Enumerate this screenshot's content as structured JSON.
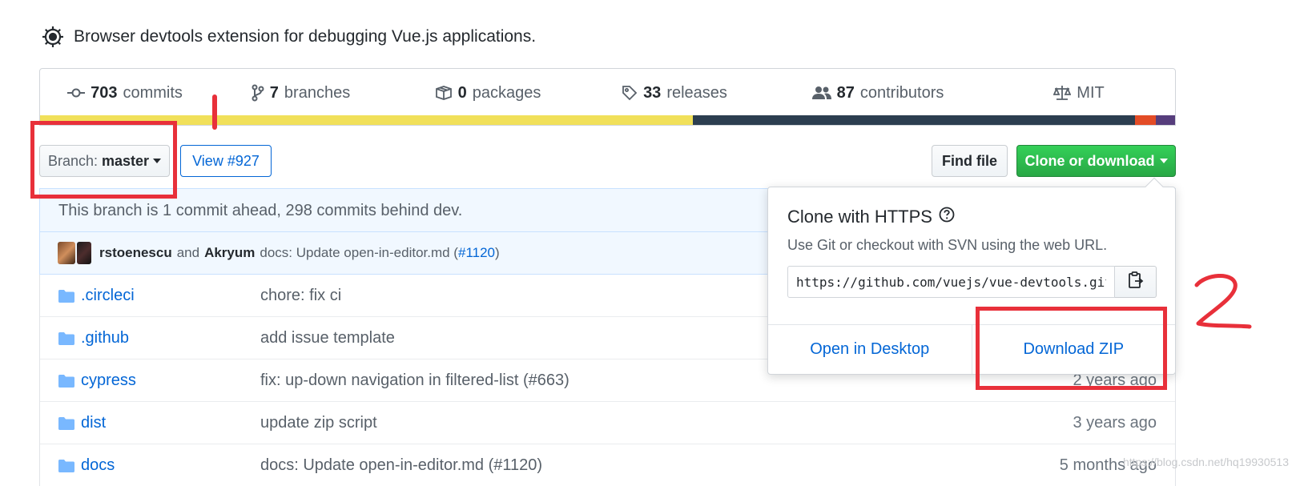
{
  "repo": {
    "description": "Browser devtools extension for debugging Vue.js applications."
  },
  "stats": [
    {
      "icon": "commits-icon",
      "count": "703",
      "label": "commits"
    },
    {
      "icon": "branch-icon",
      "count": "7",
      "label": "branches"
    },
    {
      "icon": "package-icon",
      "count": "0",
      "label": "packages"
    },
    {
      "icon": "tag-icon",
      "count": "33",
      "label": "releases"
    },
    {
      "icon": "people-icon",
      "count": "87",
      "label": "contributors"
    },
    {
      "icon": "law-icon",
      "count": "",
      "label": "MIT"
    }
  ],
  "language_bar": [
    {
      "color": "#f1e05a",
      "fraction": 0.575
    },
    {
      "color": "#2c3e50",
      "fraction": 0.39
    },
    {
      "color": "#e34c26",
      "fraction": 0.018
    },
    {
      "color": "#563d7c",
      "fraction": 0.017
    }
  ],
  "toolbar": {
    "branch_prefix": "Branch:",
    "branch_name": "master",
    "view_pr": "View #927",
    "find_file": "Find file",
    "clone_download": "Clone or download"
  },
  "branch_status": "This branch is 1 commit ahead, 298 commits behind dev.",
  "latest_commit": {
    "author1": "rstoenescu",
    "joiner": "and",
    "author2": "Akryum",
    "message_prefix": "docs: Update open-in-editor.md (",
    "pr_link": "#1120",
    "message_suffix": ")"
  },
  "files": [
    {
      "name": ".circleci",
      "message": "chore: fix ci",
      "age": ""
    },
    {
      "name": ".github",
      "message": "add issue template",
      "age": ""
    },
    {
      "name": "cypress",
      "message": "fix: up-down navigation in filtered-list (#663)",
      "age": "2 years ago"
    },
    {
      "name": "dist",
      "message": "update zip script",
      "age": "3 years ago"
    },
    {
      "name": "docs",
      "message": "docs: Update open-in-editor.md (#1120)",
      "age": "5 months ago"
    }
  ],
  "clone_popover": {
    "title": "Clone with HTTPS",
    "subtitle": "Use Git or checkout with SVN using the web URL.",
    "url": "https://github.com/vuejs/vue-devtools.git",
    "open_desktop": "Open in Desktop",
    "download_zip": "Download ZIP"
  },
  "annotations": {
    "color": "#e8303a"
  },
  "watermark": "https://blog.csdn.net/hq19930513"
}
